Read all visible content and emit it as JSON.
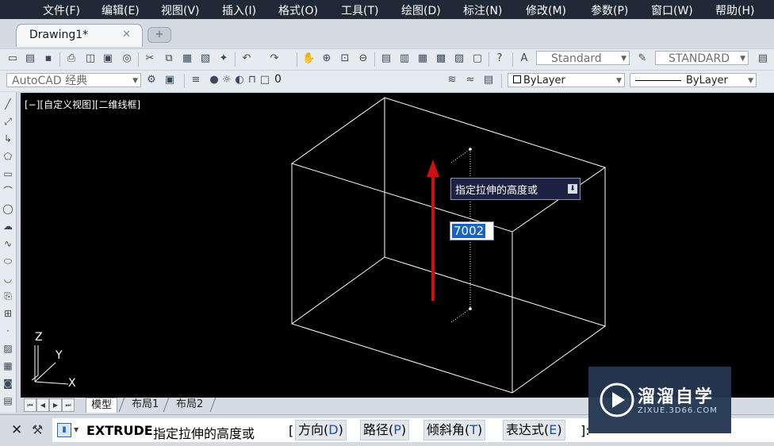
{
  "menu": [
    "文件(F)",
    "编辑(E)",
    "视图(V)",
    "插入(I)",
    "格式(O)",
    "工具(T)",
    "绘图(D)",
    "标注(N)",
    "修改(M)",
    "参数(P)",
    "窗口(W)",
    "帮助(H)"
  ],
  "doc_tab": {
    "label": "Drawing1*",
    "close": "✕",
    "new": "+"
  },
  "toolbar1": {
    "text_style": "Standard",
    "dim_style": "STANDARD"
  },
  "toolbar2": {
    "workspace": "AutoCAD 经典",
    "layer": "0",
    "color": "ByLayer",
    "linetype": "ByLayer"
  },
  "viewport": {
    "label": "[−][自定义视图][二维线框]",
    "ucs_z": "Z",
    "ucs_y": "Y",
    "ucs_x": "X"
  },
  "tooltip": {
    "text": "指定拉伸的高度或",
    "icon": "down-arrow-icon"
  },
  "dynamic_input": {
    "value": "7002"
  },
  "layout_tabs": [
    "模型",
    "布局1",
    "布局2"
  ],
  "command": {
    "name": "EXTRUDE",
    "prompt": "指定拉伸的高度或",
    "open_bracket": "[",
    "options": [
      {
        "label": "方向(",
        "key": "D",
        "close": ")"
      },
      {
        "label": "路径(",
        "key": "P",
        "close": ")"
      },
      {
        "label": "倾斜角(",
        "key": "T",
        "close": ")"
      },
      {
        "label": "表达式(",
        "key": "E",
        "close": ")"
      }
    ],
    "close_bracket": "]:"
  },
  "watermark": {
    "title": "溜溜自学",
    "sub": "ZIXUE.3D66.COM"
  },
  "colors": {
    "menubar": "#1f2a36",
    "viewport_bg": "#000000",
    "wire": "#ffffff",
    "arrow": "#d01010",
    "tooltip_bg": "#1d2242",
    "selection": "#1a63c6"
  }
}
